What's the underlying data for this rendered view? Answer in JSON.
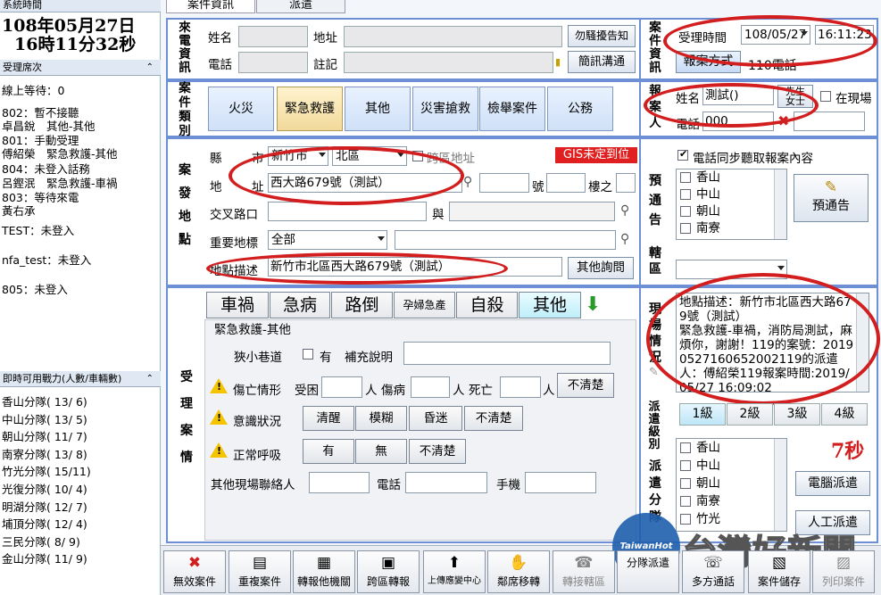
{
  "left": {
    "clock_header": "系統時間",
    "clock_date": "108年05月27日",
    "clock_time": "16時11分32秒",
    "seats_header": "受理席次",
    "seats": [
      "線上等待：0",
      "802：暫不接聽",
      "卓昌銳　其他-其他",
      "801：手動受理",
      "傅紹榮　緊急救護-其他",
      "804：未登入話務",
      "呂鏗泯　緊急救護-車禍",
      "803：等待來電",
      "黃右承",
      "TEST：未登入",
      "nfa_test：未登入",
      "805：未登入"
    ],
    "units_header": "即時可用戰力(人數/車輛數)",
    "units": [
      "香山分隊( 13/ 6)",
      "中山分隊( 13/ 5)",
      "朝山分隊( 11/ 7)",
      "南寮分隊( 13/ 8)",
      "竹光分隊( 15/11)",
      "光復分隊( 10/ 4)",
      "明湖分隊( 12/ 7)",
      "埔頂分隊( 12/ 4)",
      "三民分隊( 8/ 9)",
      "金山分隊( 11/ 9)"
    ]
  },
  "tabs": [
    "案件資訊",
    "派遣"
  ],
  "caller": {
    "section": "來電資訊",
    "name_label": "姓名",
    "address_label": "地址",
    "phone_label": "電話",
    "note_label": "註記",
    "btn_harass": "勿騷擾告知",
    "btn_sms": "簡訊溝通"
  },
  "case_info": {
    "section": "案件資訊",
    "time_label": "受理時間",
    "date_value": "108/05/27",
    "time_value": "16:11:23",
    "report_btn": "報案方式",
    "report_value": "110電話"
  },
  "categories": {
    "section": "案件類別",
    "items": [
      "火災",
      "緊急救護",
      "其他",
      "災害搶救",
      "檢舉案件",
      "公務"
    ]
  },
  "reporter": {
    "section": "報案人",
    "name_label": "姓名",
    "name_value": "測試()",
    "gender": [
      "先生",
      "女士"
    ],
    "on_site_label": "在現場",
    "phone_label": "電話",
    "phone_value": "000"
  },
  "location": {
    "section": "案發地點",
    "county_label": "縣",
    "city_label": "市",
    "county_value": "新竹市",
    "district_value": "北區",
    "cross_label": "跨區地址",
    "gis_badge": "GIS未定到位",
    "address_label": "地",
    "address_label2": "址",
    "address_value": "西大路679號（測試）",
    "num_label": "號",
    "floor_label": "樓之",
    "cross_road_label": "交叉路口",
    "and_label": "與",
    "landmark_label": "重要地標",
    "landmark_value": "全部",
    "desc_label": "地點描述",
    "desc_value": "新竹市北區西大路679號（測試）",
    "other_btn": "其他詢問"
  },
  "pre_notice": {
    "section": "預通告",
    "sync_label": "電話同步聽取報案內容",
    "units": [
      "香山",
      "中山",
      "朝山",
      "南寮"
    ],
    "btn": "預通告",
    "jurisdiction_section": "轄區"
  },
  "accept": {
    "section": "受理案情",
    "tabs": [
      "車禍",
      "急病",
      "路倒",
      "孕婦急產",
      "自殺",
      "其他"
    ],
    "subtitle": "緊急救護-其他",
    "narrow_label": "狹小巷道",
    "narrow_opt": "有",
    "supp_label": "補充說明",
    "casualty_label": "傷亡情形",
    "injured_label": "受困",
    "person1": "人",
    "sick_label": "傷病",
    "person2": "人",
    "dead_label": "死亡",
    "person3": "人",
    "unclear_btn": "不清楚",
    "conscious_label": "意識狀況",
    "conscious_opts": [
      "清醒",
      "模糊",
      "昏迷",
      "不清楚"
    ],
    "breath_label": "正常呼吸",
    "breath_opts": [
      "有",
      "無",
      "不清楚"
    ],
    "contact_label": "其他現場聯絡人",
    "phone_label": "電話",
    "mobile_label": "手機"
  },
  "scene": {
    "section": "現場情況",
    "text": "地點描述：新竹市北區西大路679號（測試）\n緊急救護-車禍，消防局測試，麻煩你，謝謝！119的案號：20190527160652002119的派遣人：傅紹榮119報案時間:2019/05/27 16:09:02"
  },
  "dispatch": {
    "level_section": "派遣級別",
    "levels": [
      "1級",
      "2級",
      "3級",
      "4級"
    ],
    "timer": "7秒",
    "units_section": "派遣分隊",
    "units": [
      "香山",
      "中山",
      "朝山",
      "南寮",
      "竹光"
    ],
    "auto_btn": "電腦派遣",
    "manual_btn": "人工派遣"
  },
  "toolbar": [
    {
      "label": "無效案件",
      "icon": "✖"
    },
    {
      "label": "重複案件",
      "icon": "▤"
    },
    {
      "label": "轉報他機關",
      "icon": "▦"
    },
    {
      "label": "跨區轉報",
      "icon": "▣"
    },
    {
      "label": "上傳應變中心",
      "icon": "⬆"
    },
    {
      "label": "鄰席移轉",
      "icon": "✋"
    },
    {
      "label": "轉接轄區",
      "icon": "☎"
    },
    {
      "label": "分隊派遣",
      "icon": ""
    },
    {
      "label": "多方通話",
      "icon": "☏"
    },
    {
      "label": "案件儲存",
      "icon": "▧"
    },
    {
      "label": "列印案件",
      "icon": "▨"
    }
  ],
  "watermark": {
    "brand": "TaiwanHot",
    "text": "台灣好新聞"
  },
  "colors": {
    "section_border": "#6c8fd6",
    "alert_red": "#d21e1e",
    "gis_red": "#e02020"
  }
}
